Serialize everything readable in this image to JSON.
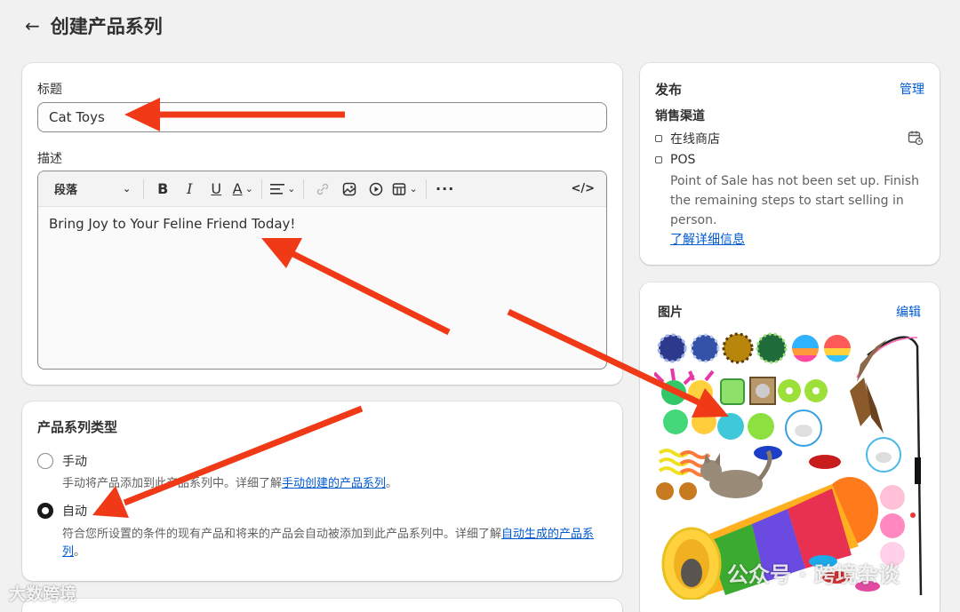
{
  "header": {
    "back_icon": "arrow-left-icon",
    "title": "创建产品系列"
  },
  "main": {
    "title_label": "标题",
    "title_value": "Cat Toys",
    "description_label": "描述",
    "toolbar": {
      "paragraph_label": "段落",
      "bold": "B",
      "italic": "I",
      "underline": "U",
      "text_color": "A",
      "more": "···",
      "code": "</>"
    },
    "description_value": "Bring Joy to Your Feline Friend Today!"
  },
  "collection_type": {
    "heading": "产品系列类型",
    "manual": {
      "label": "手动",
      "help_prefix": "手动将产品添加到此产品系列中。详细了解",
      "help_link": "手动创建的产品系列",
      "help_suffix": "。",
      "selected": false
    },
    "automated": {
      "label": "自动",
      "help_prefix": "符合您所设置的条件的现有产品和将来的产品会自动被添加到此产品系列中。详细了解",
      "help_link": "自动生成的产品系",
      "help_link_line2": "列",
      "help_suffix": "。",
      "selected": true
    }
  },
  "publishing": {
    "heading": "发布",
    "manage": "管理",
    "channels_heading": "销售渠道",
    "channels": [
      {
        "name": "在线商店"
      },
      {
        "name": "POS"
      }
    ],
    "pos_note_lines": [
      "Point of Sale has not been set up. Finish",
      "the remaining steps to start selling in",
      "person."
    ],
    "learn_more": "了解详细信息"
  },
  "image": {
    "heading": "图片",
    "edit": "编辑"
  },
  "watermarks": {
    "left": "大数跨境",
    "right": "公众号 · 跨境杂谈"
  },
  "colors": {
    "accent": "#005bd3",
    "annotation_arrow": "#f03a17"
  }
}
